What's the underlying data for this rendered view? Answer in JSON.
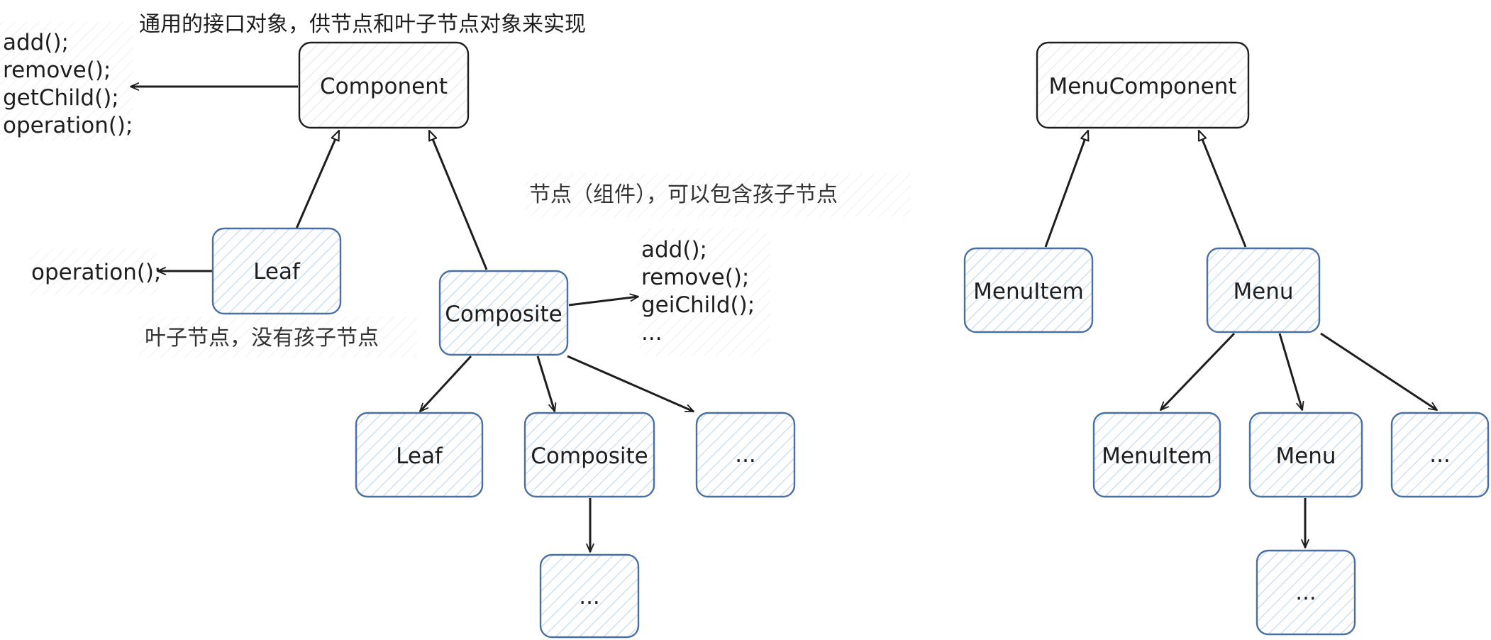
{
  "left": {
    "component": "Component",
    "leaf_top": "Leaf",
    "composite_top": "Composite",
    "leaf_child": "Leaf",
    "composite_child": "Composite",
    "ellipsis_child": "...",
    "ellipsis_grandchild": "...",
    "interface_methods": [
      "add();",
      "remove();",
      "getChild();",
      "operation();"
    ],
    "leaf_method": "operation();",
    "composite_methods": [
      "add();",
      "remove();",
      "geiChild();",
      "..."
    ],
    "note_interface": "通用的接口对象，供节点和叶子节点对象来实现",
    "note_composite": "节点（组件），可以包含孩子节点",
    "note_leaf": "叶子节点，没有孩子节点"
  },
  "right": {
    "menu_component": "MenuComponent",
    "menu_item_top": "MenuItem",
    "menu_top": "Menu",
    "menu_item_child": "MenuItem",
    "menu_child": "Menu",
    "ellipsis_child": "...",
    "ellipsis_grandchild": "..."
  },
  "colors": {
    "stroke_dark": "#1e1e1e",
    "stroke_blue": "#4a6fa5",
    "hatch_blue": "#a5c8e4",
    "hatch_grey": "#dfe3e8"
  }
}
